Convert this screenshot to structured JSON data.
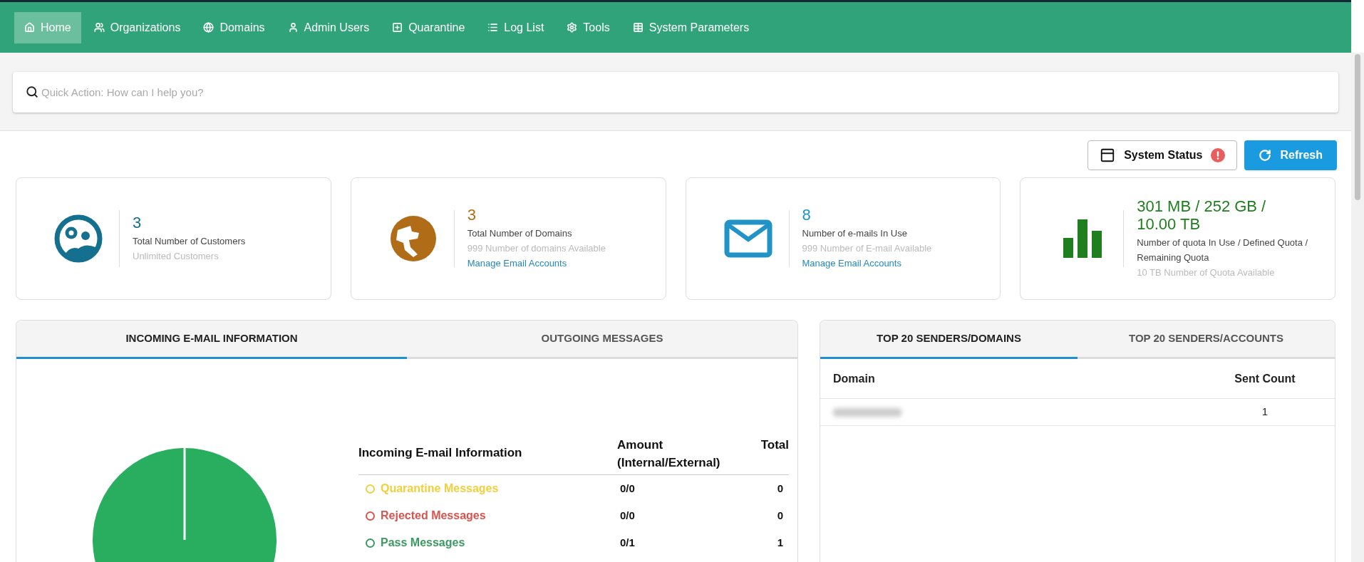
{
  "nav": {
    "items": [
      {
        "label": "Home",
        "selected": true
      },
      {
        "label": "Organizations",
        "selected": false
      },
      {
        "label": "Domains",
        "selected": false
      },
      {
        "label": "Admin Users",
        "selected": false
      },
      {
        "label": "Quarantine",
        "selected": false
      },
      {
        "label": "Log List",
        "selected": false
      },
      {
        "label": "Tools",
        "selected": false
      },
      {
        "label": "System Parameters",
        "selected": false
      }
    ]
  },
  "search": {
    "placeholder": "Quick Action: How can I help you?"
  },
  "toolbar": {
    "system_status": {
      "label": "System Status",
      "alert": true
    },
    "refresh": {
      "label": "Refresh"
    }
  },
  "stats": [
    {
      "kind": "customers",
      "color": "#156f8e",
      "value": "3",
      "label": "Total Number of Customers",
      "sub": "Unlimited Customers"
    },
    {
      "kind": "domains",
      "color": "#b06c17",
      "value": "3",
      "label": "Total Number of Domains",
      "sub": "999 Number of domains Available",
      "link": "Manage Email Accounts"
    },
    {
      "kind": "emails",
      "color": "#2193c6",
      "value": "8",
      "label": "Number of e-mails In Use",
      "sub": "999 Number of E-mail Available",
      "link": "Manage Email Accounts"
    },
    {
      "kind": "quota",
      "color": "#1f7e1e",
      "value": "301 MB / 252 GB / 10.00 TB",
      "label": "Number of quota In Use / Defined Quota / Remaining Quota",
      "sub": "10 TB Number of Quota Available"
    }
  ],
  "mail_panel": {
    "tabs": [
      {
        "label": "INCOMING E-MAIL INFORMATION",
        "selected": true
      },
      {
        "label": "OUTGOING MESSAGES",
        "selected": false
      }
    ],
    "table": {
      "columns": [
        "Incoming E-mail Information",
        "Amount (Internal/External)",
        "Total"
      ],
      "rows": [
        {
          "label": "Quarantine Messages",
          "color": "#f2cf3c",
          "amount": "0/0",
          "total": "0"
        },
        {
          "label": "Rejected Messages",
          "color": "#d9534f",
          "amount": "0/0",
          "total": "0"
        },
        {
          "label": "Pass Messages",
          "color": "#3a9a5f",
          "amount": "0/1",
          "total": "1"
        }
      ]
    }
  },
  "senders_panel": {
    "tabs": [
      {
        "label": "TOP 20 SENDERS/DOMAINS",
        "selected": true
      },
      {
        "label": "TOP 20 SENDERS/ACCOUNTS",
        "selected": false
      }
    ],
    "columns": [
      "Domain",
      "Sent Count"
    ],
    "rows": [
      {
        "count": "1"
      }
    ]
  }
}
